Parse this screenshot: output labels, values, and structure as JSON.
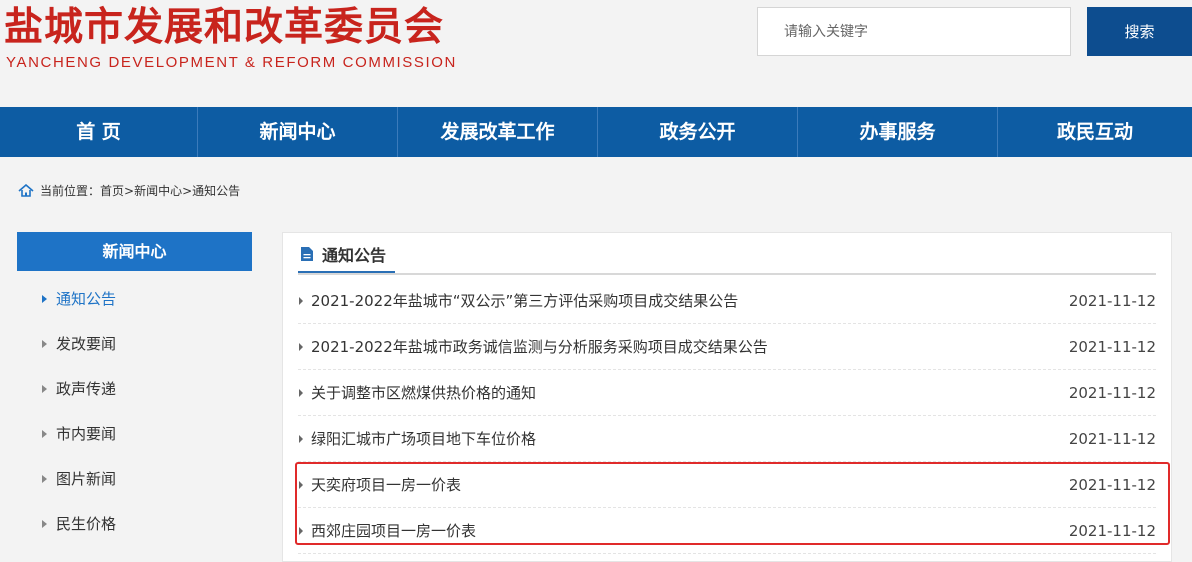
{
  "header": {
    "title": "盐城市发展和改革委员会",
    "subtitle": "YANCHENG DEVELOPMENT & REFORM COMMISSION",
    "search_placeholder": "请输入关键字",
    "search_button": "搜索",
    "brand_color": "#c8241d"
  },
  "nav": {
    "items": [
      {
        "label": "首 页"
      },
      {
        "label": "新闻中心"
      },
      {
        "label": "发展改革工作"
      },
      {
        "label": "政务公开"
      },
      {
        "label": "办事服务"
      },
      {
        "label": "政民互动"
      }
    ],
    "color": "#0d5ca3"
  },
  "breadcrumb": {
    "icon": "home-icon",
    "prefix": "当前位置：",
    "items": [
      "首页",
      "新闻中心",
      "通知公告"
    ],
    "separator": "> "
  },
  "sidebar": {
    "title": "新闻中心",
    "items": [
      {
        "label": "通知公告",
        "active": true
      },
      {
        "label": "发改要闻"
      },
      {
        "label": "政声传递"
      },
      {
        "label": "市内要闻"
      },
      {
        "label": "图片新闻"
      },
      {
        "label": "民生价格"
      }
    ]
  },
  "main": {
    "title": "通知公告",
    "icon": "document-icon",
    "items": [
      {
        "title": "2021-2022年盐城市“双公示”第三方评估采购项目成交结果公告",
        "date": "2021-11-12"
      },
      {
        "title": "2021-2022年盐城市政务诚信监测与分析服务采购项目成交结果公告",
        "date": "2021-11-12"
      },
      {
        "title": "关于调整市区燃煤供热价格的通知",
        "date": "2021-11-12"
      },
      {
        "title": "绿阳汇城市广场项目地下车位价格",
        "date": "2021-11-12"
      },
      {
        "title": "天奕府项目一房一价表",
        "date": "2021-11-12"
      },
      {
        "title": "西郊庄园项目一房一价表",
        "date": "2021-11-12"
      }
    ],
    "highlight_color": "#e02a2a"
  }
}
